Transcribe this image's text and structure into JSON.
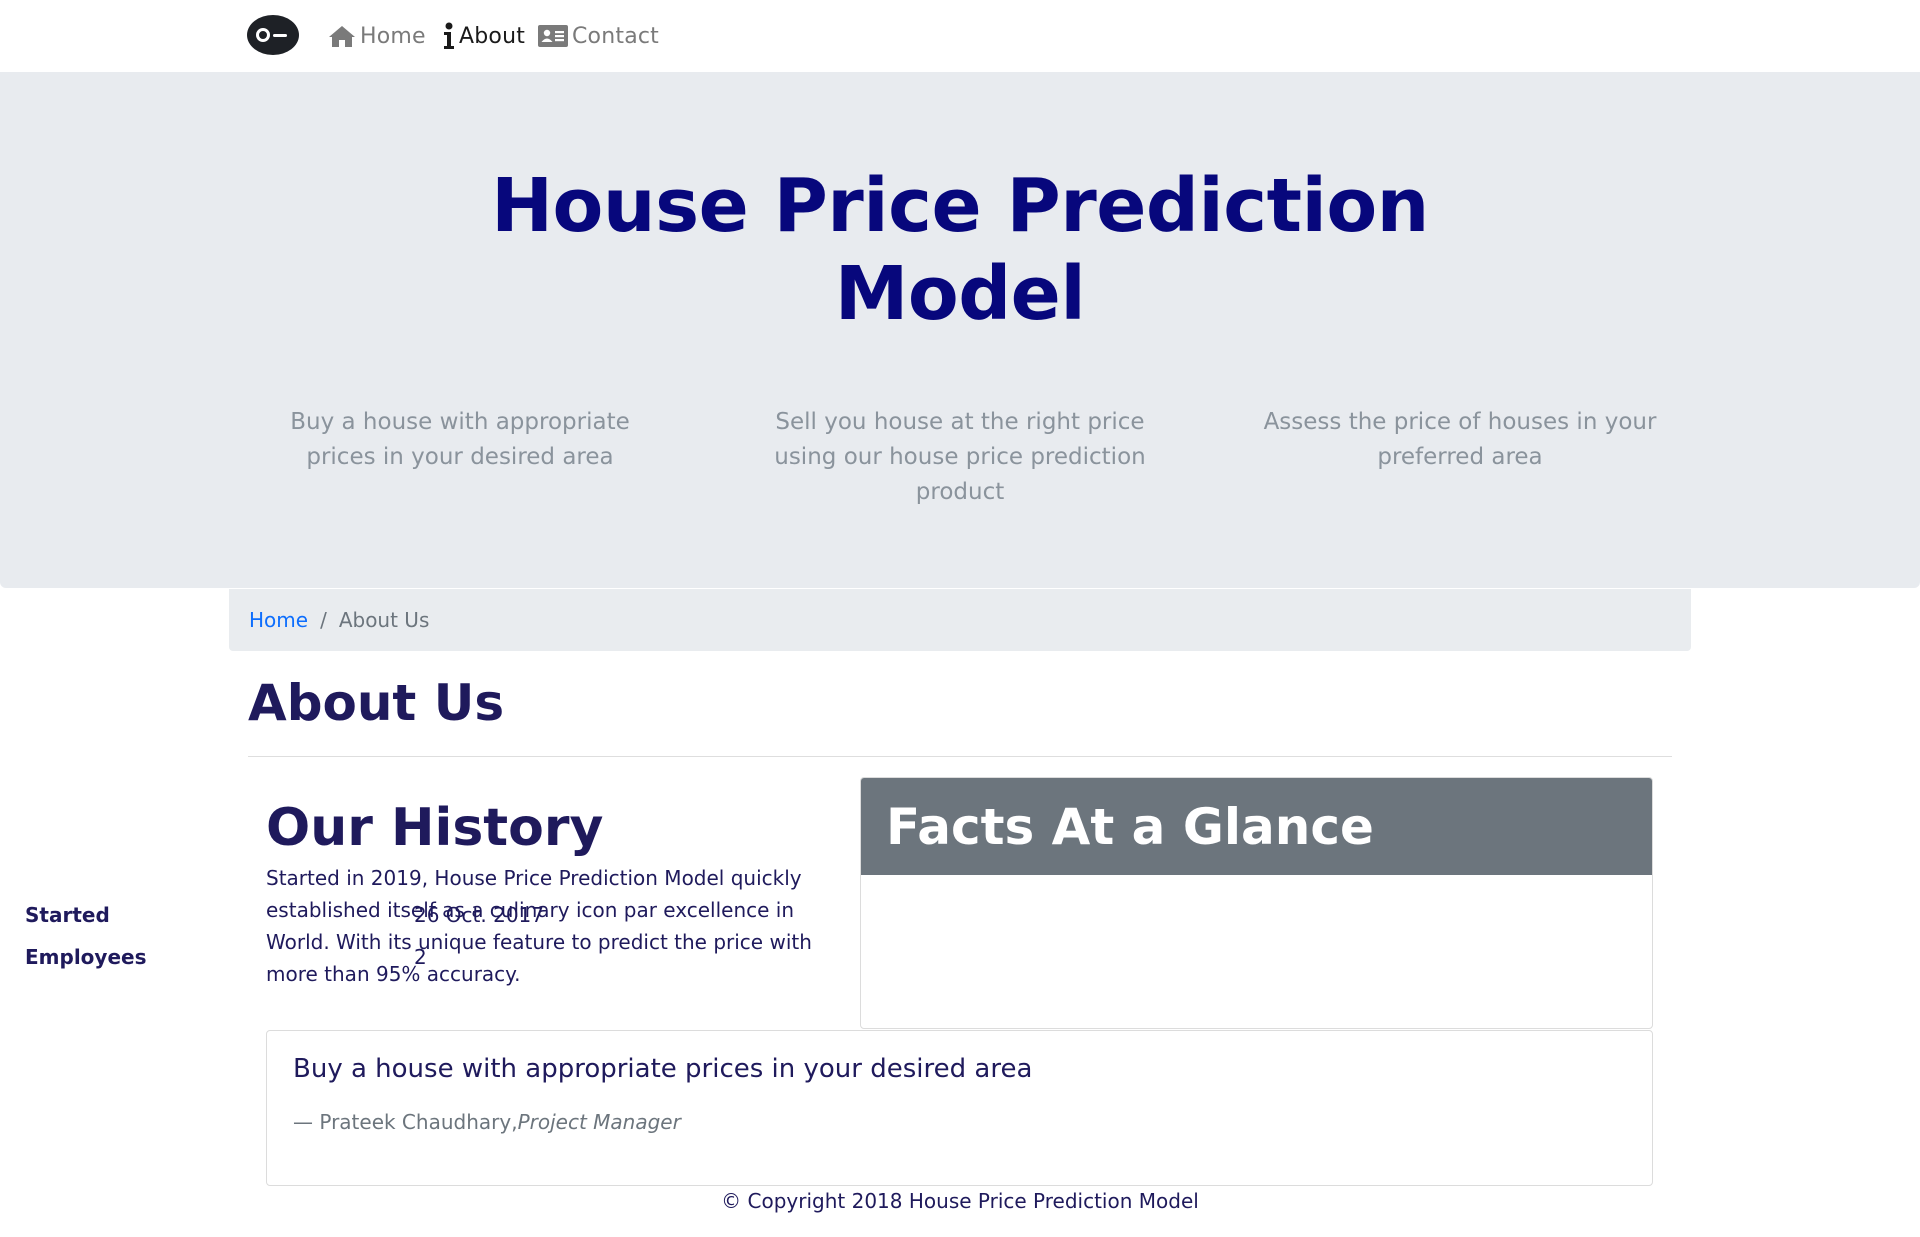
{
  "navbar": {
    "logo_icon": "brand-logo-icon",
    "items": [
      {
        "label": "Home",
        "icon": "home-icon",
        "active": false
      },
      {
        "label": "About",
        "icon": "info-icon",
        "active": true
      },
      {
        "label": "Contact",
        "icon": "contact-card-icon",
        "active": false
      }
    ]
  },
  "hero": {
    "title_line1": "House Price Prediction",
    "title_line2": "Model",
    "columns": [
      "Buy a house with appropriate prices in your desired area",
      "Sell you house at the right price using our house price prediction product",
      "Assess the price of houses in your preferred area"
    ]
  },
  "breadcrumb": {
    "home": "Home",
    "separator": "/",
    "current": "About Us"
  },
  "page": {
    "title": "About Us"
  },
  "history": {
    "title": "Our History",
    "text": "Started in 2019, House Price Prediction Model quickly established itself as a culinary icon par excellence in World. With its unique feature to predict the price with more than 95% accuracy."
  },
  "facts": {
    "title": "Facts At a Glance",
    "rows": [
      {
        "key": "Started",
        "value": "26 Oct. 2017"
      },
      {
        "key": "Employees",
        "value": "2"
      }
    ]
  },
  "quote": {
    "text": "Buy a house with appropriate prices in your desired area",
    "author": "— Prateek Chaudhary,",
    "role": "Project Manager"
  },
  "footer": {
    "copyright": "© Copyright 2018 House Price Prediction Model"
  },
  "colors": {
    "hero_bg": "#e8ebef",
    "hero_title": "#07077c",
    "text_primary": "#1f1a5c",
    "link": "#0d6efd",
    "card_header": "#6c757d"
  }
}
